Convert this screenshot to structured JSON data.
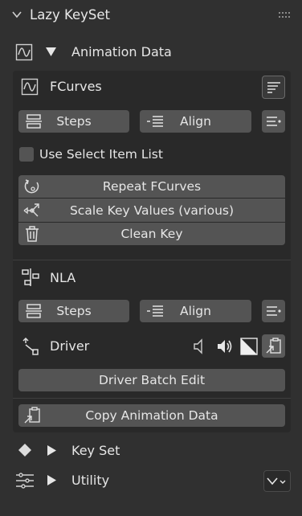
{
  "panel": {
    "title": "Lazy KeySet"
  },
  "animation_data": {
    "label": "Animation Data",
    "fcurves": {
      "label": "FCurves",
      "steps_label": "Steps",
      "align_label": "Align",
      "use_select_item_list_label": "Use Select Item List",
      "repeat_label": "Repeat FCurves",
      "scale_label": "Scale Key Values (various)",
      "clean_label": "Clean Key"
    },
    "nla": {
      "label": "NLA",
      "steps_label": "Steps",
      "align_label": "Align"
    },
    "driver": {
      "label": "Driver",
      "batch_edit_label": "Driver Batch Edit",
      "copy_anim_label": "Copy Animation Data"
    }
  },
  "key_set": {
    "label": "Key Set"
  },
  "utility": {
    "label": "Utility"
  },
  "icons": [
    "chevron-down-icon",
    "drag-grip-icon",
    "graph-curve-icon",
    "triangle-down-icon",
    "sort-lines-icon",
    "steps-icon",
    "align-list-icon",
    "list-menu-icon",
    "repeat-icon",
    "scale-icon",
    "trash-icon",
    "nla-icon",
    "driver-icon",
    "speaker-mute-icon",
    "speaker-on-icon",
    "contrast-icon",
    "paste-icon",
    "diamond-icon",
    "triangle-right-icon",
    "sliders-icon",
    "dropdown-chevron-icon"
  ]
}
